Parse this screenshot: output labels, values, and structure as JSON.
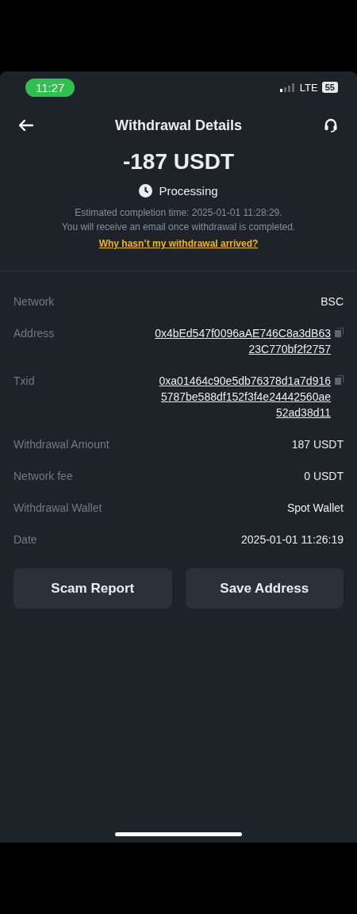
{
  "status_bar": {
    "time": "11:27",
    "network": "LTE",
    "battery": "55"
  },
  "header": {
    "title": "Withdrawal Details"
  },
  "amount": "-187 USDT",
  "status": {
    "label": "Processing"
  },
  "note_lines": [
    "Estimated completion time: 2025-01-01 11:28:29.",
    "You will receive an email once withdrawal is completed."
  ],
  "help_link": "Why hasn’t my withdrawal arrived?",
  "details": [
    {
      "label": "Network",
      "kind": "plain",
      "lines": [
        "BSC"
      ]
    },
    {
      "label": "Address",
      "kind": "copyable",
      "lines": [
        "0x4bEd547f0096aAE746C8a3dB63",
        "23C770bf2f2757"
      ]
    },
    {
      "label": "Txid",
      "kind": "copyable",
      "lines": [
        "0xa01464c90e5db76378d1a7d916",
        "5787be588df152f3f4e24442560ae",
        "52ad38d11"
      ]
    },
    {
      "label": "Withdrawal Amount",
      "kind": "plain",
      "lines": [
        "187 USDT"
      ]
    },
    {
      "label": "Network fee",
      "kind": "plain",
      "lines": [
        "0 USDT"
      ]
    },
    {
      "label": "Withdrawal Wallet",
      "kind": "plain",
      "lines": [
        "Spot Wallet"
      ]
    },
    {
      "label": "Date",
      "kind": "plain",
      "lines": [
        "2025-01-01 11:26:19"
      ]
    }
  ],
  "buttons": [
    "Scam Report",
    "Save Address"
  ]
}
